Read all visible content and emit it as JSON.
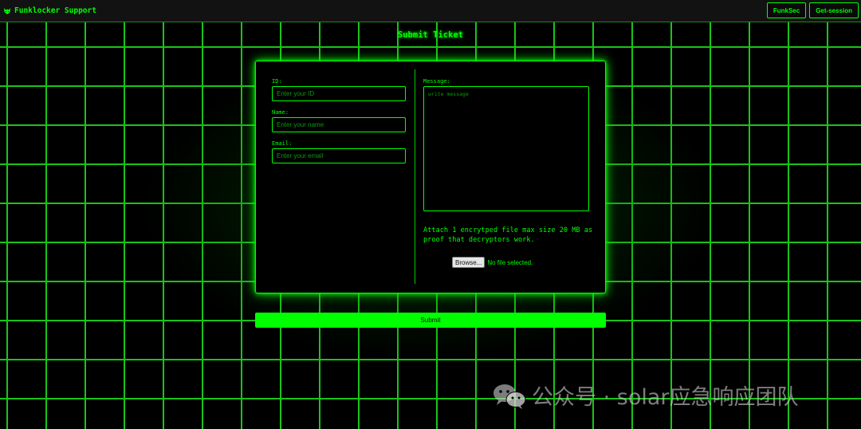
{
  "header": {
    "brand_icon": "wolf-icon",
    "brand_title": "Funklocker Support",
    "nav": [
      {
        "label": "FunkSec"
      },
      {
        "label": "Get-session"
      }
    ]
  },
  "page_title": "Submit Ticket",
  "form": {
    "id": {
      "label": "ID:",
      "value": "",
      "placeholder": "Enter your ID"
    },
    "name": {
      "label": "Name:",
      "value": "",
      "placeholder": "Enter your name"
    },
    "email": {
      "label": "Email:",
      "value": "",
      "placeholder": "Enter your email"
    },
    "message": {
      "label": "Message:",
      "value": "",
      "placeholder": "write message"
    },
    "attach_text": "Attach 1 encrytped file max size 20 MB as proof that decryptors work.",
    "file": {
      "button_label": "Browse...",
      "status": "No file selected."
    },
    "submit_label": "Submit"
  },
  "colors": {
    "accent": "#00ff00",
    "background": "#000000",
    "header_bg": "#121212"
  },
  "watermark": {
    "icon": "wechat-icon",
    "text": "公众号 · solar应急响应团队"
  }
}
